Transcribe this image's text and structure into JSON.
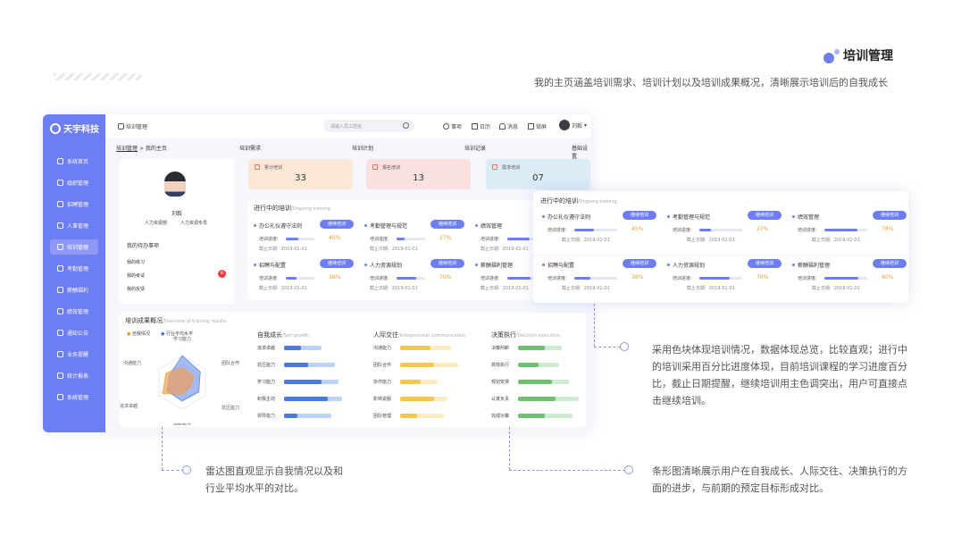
{
  "header": {
    "title": "培训管理",
    "subtitle": "我的主页涵盖培训需求、培训计划以及培训成果概况，清晰展示培训后的自我成长"
  },
  "app": {
    "logo": "天宇科技",
    "topbar": {
      "title": "培训管理",
      "search_placeholder": "请输入员工姓名",
      "items": [
        "事项",
        "日历",
        "消息",
        "锁屏"
      ],
      "user": "刘毅"
    },
    "nav": [
      "系统首页",
      "组织管理",
      "招聘管理",
      "人事管理",
      "培训管理",
      "考勤管理",
      "薪酬福利",
      "绩效管理",
      "通知公告",
      "业务提醒",
      "统计报表",
      "系统管理"
    ],
    "nav_active": 4,
    "breadcrumb": {
      "current": "培训管理",
      "sub": "> 我的主页"
    },
    "tabs": [
      "培训需求",
      "培训计划",
      "培训记录",
      "基础设置"
    ],
    "profile": {
      "name": "刘毅",
      "dept": "人力资源部",
      "role": "人力资源专员"
    },
    "todo": {
      "title": "我的待办事项",
      "items": [
        "我的练习",
        "我的考试",
        "我的反馈"
      ],
      "badge": "6"
    },
    "stats": [
      {
        "label": "累计培训",
        "value": "33",
        "color": "#fbe7d6"
      },
      {
        "label": "报名培训",
        "value": "13",
        "color": "#fbe0e0"
      },
      {
        "label": "需求培训",
        "value": "07",
        "color": "#dcecf7"
      }
    ],
    "ongoing": {
      "title": "进行中的培训",
      "subtitle": "/Ongoing training",
      "progress_label": "培训进度:",
      "date_label": "截止日期:",
      "button": "继续培训",
      "items": [
        {
          "name": "办公礼仪遵守法则",
          "progress": 45,
          "pct": "45%",
          "date": "2019-01-01"
        },
        {
          "name": "考勤管理与规范",
          "progress": 27,
          "pct": "27%",
          "date": "2019-01-01"
        },
        {
          "name": "绩效管理",
          "progress": 78,
          "pct": "78%",
          "date": "2019-01-01"
        },
        {
          "name": "招聘与配置",
          "progress": 38,
          "pct": "38%",
          "date": "2019-01-01"
        },
        {
          "name": "人力资源规划",
          "progress": 70,
          "pct": "70%",
          "date": "2019-01-01"
        },
        {
          "name": "薪酬福利管理",
          "progress": 80,
          "pct": "80%",
          "date": "2019-01-01"
        }
      ]
    },
    "results": {
      "title": "培训成果概况",
      "subtitle": "/Overview of training results",
      "legend": [
        "自我情况",
        "行业平均水平"
      ],
      "radar_axes": [
        "学习能力",
        "团队合作",
        "抗压能力",
        "创新能力",
        "追求卓越",
        "沟通能力"
      ],
      "groups": [
        {
          "title": "自我成长",
          "subtitle": "/Self growth",
          "color": "#4a79e0",
          "light": "#bcd3f7",
          "items": [
            {
              "label": "追求卓越",
              "self": 0.25,
              "avg": 0.55
            },
            {
              "label": "抗压能力",
              "self": 0.35,
              "avg": 0.75
            },
            {
              "label": "学习能力",
              "self": 0.55,
              "avg": 0.8
            },
            {
              "label": "积极主动",
              "self": 0.65,
              "avg": 0.85
            },
            {
              "label": "领导能力",
              "self": 0.2,
              "avg": 0.7
            }
          ]
        },
        {
          "title": "人际交往",
          "subtitle": "/Interpersonal communication",
          "color": "#f2c94c",
          "light": "#fbedc0",
          "items": [
            {
              "label": "沟通能力",
              "self": 0.45,
              "avg": 0.75
            },
            {
              "label": "团队合作",
              "self": 0.5,
              "avg": 0.85
            },
            {
              "label": "协作能力",
              "self": 0.3,
              "avg": 0.55
            },
            {
              "label": "影响说服",
              "self": 0.5,
              "avg": 0.7
            },
            {
              "label": "团队管理",
              "self": 0.25,
              "avg": 0.65
            }
          ]
        },
        {
          "title": "决策执行",
          "subtitle": "/Decision execution",
          "color": "#6cc070",
          "light": "#cdeccf",
          "items": [
            {
              "label": "决策判断",
              "self": 0.4,
              "avg": 0.65
            },
            {
              "label": "高效执行",
              "self": 0.3,
              "avg": 0.6
            },
            {
              "label": "规划安排",
              "self": 0.5,
              "avg": 0.75
            },
            {
              "label": "认真负责",
              "self": 0.55,
              "avg": 0.9
            },
            {
              "label": "完成对策",
              "self": 0.4,
              "avg": 0.8
            }
          ]
        }
      ]
    }
  },
  "annotations": {
    "right": "采用色块体现培训情况，数据体现总览，比较直观；进行中的培训采用百分比进度体现，目前培训课程的学习进度百分比，截止日期提醒，继续培训用主色调突出，用户可直接点击继续培训。",
    "radar": "雷达图直观显示自我情况以及和行业平均水平的对比。",
    "bars": "条形图清晰展示用户在自我成长、人际交往、决策执行的方面的进步，与前期的预定目标形成对比。"
  }
}
